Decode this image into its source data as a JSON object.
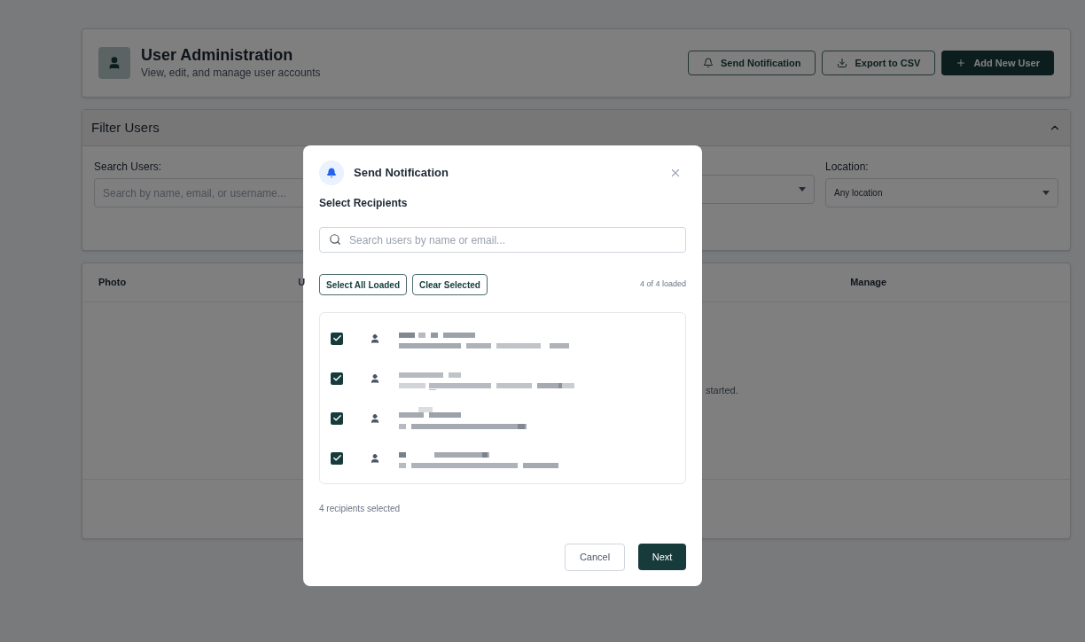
{
  "header": {
    "title": "User Administration",
    "subtitle": "View, edit, and manage user accounts",
    "buttons": [
      {
        "kind": "outline",
        "label": "Send Notification"
      },
      {
        "kind": "outline",
        "label": "Export to CSV"
      },
      {
        "kind": "primary",
        "label": "Add New User"
      }
    ]
  },
  "filters": {
    "title": "Filter Users",
    "expanded": true,
    "search": {
      "label": "Search Users:",
      "placeholder": "Search by name, email, or username..."
    },
    "location": {
      "label": "Location:",
      "value": "Any location"
    }
  },
  "table": {
    "columns": [
      "Photo",
      "U",
      "Manage"
    ],
    "empty_text": "started."
  },
  "dialog": {
    "title": "Send Notification",
    "section": "Select Recipients",
    "search_placeholder": "Search users by name or email...",
    "actions": [
      "Select All Loaded",
      "Clear Selected"
    ],
    "loaded": "4 of 4 loaded",
    "recipients": [
      {
        "checked": true
      },
      {
        "checked": true
      },
      {
        "checked": true
      },
      {
        "checked": true
      }
    ],
    "selected_count": "4 recipients selected",
    "cancel": "Cancel",
    "next": "Next"
  }
}
